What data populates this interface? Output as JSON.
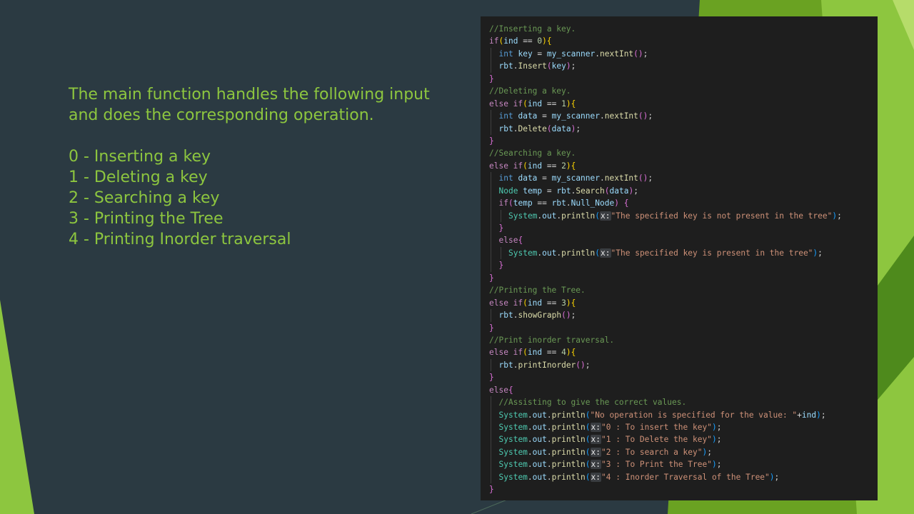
{
  "slide": {
    "heading": "The main function handles the following input and does the corresponding operation.",
    "options": [
      "0 - Inserting a key",
      "1 - Deleting a key",
      "2 - Searching a key",
      "3 - Printing the Tree",
      "4 - Printing Inorder traversal"
    ]
  },
  "colors": {
    "background": "#2b3a42",
    "accent_green": "#8dc63f",
    "code_background": "#1e1e1e"
  },
  "code": {
    "language": "java",
    "lines": [
      {
        "indent": 0,
        "tokens": [
          [
            "cm",
            "//Inserting a key."
          ]
        ]
      },
      {
        "indent": 0,
        "tokens": [
          [
            "kw",
            "if"
          ],
          [
            "p1",
            "("
          ],
          [
            "vr",
            "ind"
          ],
          [
            "op",
            " == "
          ],
          [
            "nm",
            "0"
          ],
          [
            "p1",
            ")"
          ],
          [
            "p1",
            "{"
          ]
        ]
      },
      {
        "indent": 1,
        "tokens": [
          [
            "ty",
            "int"
          ],
          [
            "op",
            " "
          ],
          [
            "vr",
            "key"
          ],
          [
            "op",
            " = "
          ],
          [
            "vr",
            "my_scanner"
          ],
          [
            "op",
            "."
          ],
          [
            "fn",
            "nextInt"
          ],
          [
            "p2",
            "("
          ],
          [
            "p2",
            ")"
          ],
          [
            "op",
            ";"
          ]
        ]
      },
      {
        "indent": 1,
        "tokens": [
          [
            "vr",
            "rbt"
          ],
          [
            "op",
            "."
          ],
          [
            "fn",
            "Insert"
          ],
          [
            "p2",
            "("
          ],
          [
            "vr",
            "key"
          ],
          [
            "p2",
            ")"
          ],
          [
            "op",
            ";"
          ]
        ]
      },
      {
        "indent": 0,
        "tokens": [
          [
            "p2",
            "}"
          ]
        ]
      },
      {
        "indent": 0,
        "tokens": [
          [
            "cm",
            "//Deleting a key."
          ]
        ]
      },
      {
        "indent": 0,
        "tokens": [
          [
            "kw",
            "else if"
          ],
          [
            "p1",
            "("
          ],
          [
            "vr",
            "ind"
          ],
          [
            "op",
            " == "
          ],
          [
            "nm",
            "1"
          ],
          [
            "p1",
            ")"
          ],
          [
            "p1",
            "{"
          ]
        ]
      },
      {
        "indent": 1,
        "tokens": [
          [
            "ty",
            "int"
          ],
          [
            "op",
            " "
          ],
          [
            "vr",
            "data"
          ],
          [
            "op",
            " = "
          ],
          [
            "vr",
            "my_scanner"
          ],
          [
            "op",
            "."
          ],
          [
            "fn",
            "nextInt"
          ],
          [
            "p2",
            "("
          ],
          [
            "p2",
            ")"
          ],
          [
            "op",
            ";"
          ]
        ]
      },
      {
        "indent": 1,
        "tokens": [
          [
            "vr",
            "rbt"
          ],
          [
            "op",
            "."
          ],
          [
            "fn",
            "Delete"
          ],
          [
            "p2",
            "("
          ],
          [
            "vr",
            "data"
          ],
          [
            "p2",
            ")"
          ],
          [
            "op",
            ";"
          ]
        ]
      },
      {
        "indent": 0,
        "tokens": [
          [
            "p2",
            "}"
          ]
        ]
      },
      {
        "indent": 0,
        "tokens": [
          [
            "cm",
            "//Searching a key."
          ]
        ]
      },
      {
        "indent": 0,
        "tokens": [
          [
            "kw",
            "else if"
          ],
          [
            "p1",
            "("
          ],
          [
            "vr",
            "ind"
          ],
          [
            "op",
            " == "
          ],
          [
            "nm",
            "2"
          ],
          [
            "p1",
            ")"
          ],
          [
            "p1",
            "{"
          ]
        ]
      },
      {
        "indent": 1,
        "tokens": [
          [
            "ty",
            "int"
          ],
          [
            "op",
            " "
          ],
          [
            "vr",
            "data"
          ],
          [
            "op",
            " = "
          ],
          [
            "vr",
            "my_scanner"
          ],
          [
            "op",
            "."
          ],
          [
            "fn",
            "nextInt"
          ],
          [
            "p2",
            "("
          ],
          [
            "p2",
            ")"
          ],
          [
            "op",
            ";"
          ]
        ]
      },
      {
        "indent": 1,
        "tokens": [
          [
            "cl",
            "Node"
          ],
          [
            "op",
            " "
          ],
          [
            "vr",
            "temp"
          ],
          [
            "op",
            " = "
          ],
          [
            "vr",
            "rbt"
          ],
          [
            "op",
            "."
          ],
          [
            "fn",
            "Search"
          ],
          [
            "p2",
            "("
          ],
          [
            "vr",
            "data"
          ],
          [
            "p2",
            ")"
          ],
          [
            "op",
            ";"
          ]
        ]
      },
      {
        "indent": 1,
        "tokens": [
          [
            "kw",
            "if"
          ],
          [
            "p2",
            "("
          ],
          [
            "vr",
            "temp"
          ],
          [
            "op",
            " == "
          ],
          [
            "vr",
            "rbt"
          ],
          [
            "op",
            "."
          ],
          [
            "vr",
            "Null_Node"
          ],
          [
            "p2",
            ")"
          ],
          [
            "op",
            " "
          ],
          [
            "p2",
            "{"
          ]
        ]
      },
      {
        "indent": 2,
        "tokens": [
          [
            "cl",
            "System"
          ],
          [
            "op",
            "."
          ],
          [
            "vr",
            "out"
          ],
          [
            "op",
            "."
          ],
          [
            "fn",
            "println"
          ],
          [
            "p3",
            "("
          ],
          [
            "hn",
            "x:"
          ],
          [
            "st",
            "\"The specified key is not present in the tree\""
          ],
          [
            "p3",
            ")"
          ],
          [
            "op",
            ";"
          ]
        ]
      },
      {
        "indent": 1,
        "tokens": [
          [
            "p2",
            "}"
          ]
        ]
      },
      {
        "indent": 1,
        "tokens": [
          [
            "kw",
            "else"
          ],
          [
            "p2",
            "{"
          ]
        ]
      },
      {
        "indent": 2,
        "tokens": [
          [
            "cl",
            "System"
          ],
          [
            "op",
            "."
          ],
          [
            "vr",
            "out"
          ],
          [
            "op",
            "."
          ],
          [
            "fn",
            "println"
          ],
          [
            "p3",
            "("
          ],
          [
            "hn",
            "x:"
          ],
          [
            "st",
            "\"The specified key is present in the tree\""
          ],
          [
            "p3",
            ")"
          ],
          [
            "op",
            ";"
          ]
        ]
      },
      {
        "indent": 1,
        "tokens": [
          [
            "p2",
            "}"
          ]
        ]
      },
      {
        "indent": 0,
        "tokens": [
          [
            "p2",
            "}"
          ]
        ]
      },
      {
        "indent": 0,
        "tokens": [
          [
            "cm",
            "//Printing the Tree."
          ]
        ]
      },
      {
        "indent": 0,
        "tokens": [
          [
            "kw",
            "else if"
          ],
          [
            "p1",
            "("
          ],
          [
            "vr",
            "ind"
          ],
          [
            "op",
            " == "
          ],
          [
            "nm",
            "3"
          ],
          [
            "p1",
            ")"
          ],
          [
            "p1",
            "{"
          ]
        ]
      },
      {
        "indent": 1,
        "tokens": [
          [
            "vr",
            "rbt"
          ],
          [
            "op",
            "."
          ],
          [
            "fn",
            "showGraph"
          ],
          [
            "p2",
            "("
          ],
          [
            "p2",
            ")"
          ],
          [
            "op",
            ";"
          ]
        ]
      },
      {
        "indent": 0,
        "tokens": [
          [
            "p2",
            "}"
          ]
        ]
      },
      {
        "indent": 0,
        "tokens": [
          [
            "cm",
            "//Print inorder traversal."
          ]
        ]
      },
      {
        "indent": 0,
        "tokens": [
          [
            "kw",
            "else if"
          ],
          [
            "p1",
            "("
          ],
          [
            "vr",
            "ind"
          ],
          [
            "op",
            " == "
          ],
          [
            "nm",
            "4"
          ],
          [
            "p1",
            ")"
          ],
          [
            "p1",
            "{"
          ]
        ]
      },
      {
        "indent": 1,
        "tokens": [
          [
            "vr",
            "rbt"
          ],
          [
            "op",
            "."
          ],
          [
            "fn",
            "printInorder"
          ],
          [
            "p2",
            "("
          ],
          [
            "p2",
            ")"
          ],
          [
            "op",
            ";"
          ]
        ]
      },
      {
        "indent": 0,
        "tokens": [
          [
            "p2",
            "}"
          ]
        ]
      },
      {
        "indent": 0,
        "tokens": [
          [
            "kw",
            "else"
          ],
          [
            "p2",
            "{"
          ]
        ]
      },
      {
        "indent": 1,
        "tokens": [
          [
            "cm",
            "//Assisting to give the correct values."
          ]
        ]
      },
      {
        "indent": 1,
        "tokens": [
          [
            "cl",
            "System"
          ],
          [
            "op",
            "."
          ],
          [
            "vr",
            "out"
          ],
          [
            "op",
            "."
          ],
          [
            "fn",
            "println"
          ],
          [
            "p3",
            "("
          ],
          [
            "st",
            "\"No operation is specified for the value: \""
          ],
          [
            "op",
            "+"
          ],
          [
            "vr",
            "ind"
          ],
          [
            "p3",
            ")"
          ],
          [
            "op",
            ";"
          ]
        ]
      },
      {
        "indent": 1,
        "tokens": [
          [
            "cl",
            "System"
          ],
          [
            "op",
            "."
          ],
          [
            "vr",
            "out"
          ],
          [
            "op",
            "."
          ],
          [
            "fn",
            "println"
          ],
          [
            "p3",
            "("
          ],
          [
            "hn",
            "x:"
          ],
          [
            "st",
            "\"0 : To insert the key\""
          ],
          [
            "p3",
            ")"
          ],
          [
            "op",
            ";"
          ]
        ]
      },
      {
        "indent": 1,
        "tokens": [
          [
            "cl",
            "System"
          ],
          [
            "op",
            "."
          ],
          [
            "vr",
            "out"
          ],
          [
            "op",
            "."
          ],
          [
            "fn",
            "println"
          ],
          [
            "p3",
            "("
          ],
          [
            "hn",
            "x:"
          ],
          [
            "st",
            "\"1 : To Delete the key\""
          ],
          [
            "p3",
            ")"
          ],
          [
            "op",
            ";"
          ]
        ]
      },
      {
        "indent": 1,
        "tokens": [
          [
            "cl",
            "System"
          ],
          [
            "op",
            "."
          ],
          [
            "vr",
            "out"
          ],
          [
            "op",
            "."
          ],
          [
            "fn",
            "println"
          ],
          [
            "p3",
            "("
          ],
          [
            "hn",
            "x:"
          ],
          [
            "st",
            "\"2 : To search a key\""
          ],
          [
            "p3",
            ")"
          ],
          [
            "op",
            ";"
          ]
        ]
      },
      {
        "indent": 1,
        "tokens": [
          [
            "cl",
            "System"
          ],
          [
            "op",
            "."
          ],
          [
            "vr",
            "out"
          ],
          [
            "op",
            "."
          ],
          [
            "fn",
            "println"
          ],
          [
            "p3",
            "("
          ],
          [
            "hn",
            "x:"
          ],
          [
            "st",
            "\"3 : To Print the Tree\""
          ],
          [
            "p3",
            ")"
          ],
          [
            "op",
            ";"
          ]
        ]
      },
      {
        "indent": 1,
        "tokens": [
          [
            "cl",
            "System"
          ],
          [
            "op",
            "."
          ],
          [
            "vr",
            "out"
          ],
          [
            "op",
            "."
          ],
          [
            "fn",
            "println"
          ],
          [
            "p3",
            "("
          ],
          [
            "hn",
            "x:"
          ],
          [
            "st",
            "\"4 : Inorder Traversal of the Tree\""
          ],
          [
            "p3",
            ")"
          ],
          [
            "op",
            ";"
          ]
        ]
      },
      {
        "indent": 0,
        "tokens": [
          [
            "p2",
            "}"
          ]
        ]
      }
    ]
  }
}
